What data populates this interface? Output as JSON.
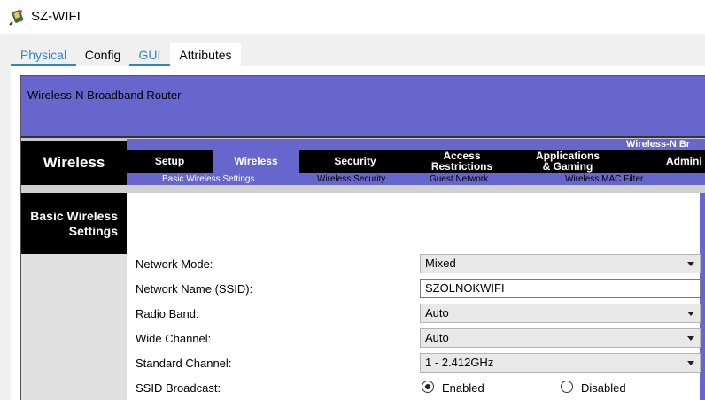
{
  "window": {
    "title": "SZ-WIFI",
    "icon": "router-device-icon"
  },
  "tabs": [
    {
      "label": "Physical",
      "active": false
    },
    {
      "label": "Config",
      "active": false
    },
    {
      "label": "GUI",
      "active": true
    },
    {
      "label": "Attributes",
      "active": false
    }
  ],
  "router": {
    "banner_title": "Wireless-N Broadband Router",
    "section_title": "Wireless",
    "product_label": "Wireless-N Br",
    "nav": [
      {
        "line1": "Setup"
      },
      {
        "line1": "Wireless",
        "selected": true
      },
      {
        "line1": "Security"
      },
      {
        "line1": "Access",
        "line2": "Restrictions"
      },
      {
        "line1": "Applications",
        "line2": "& Gaming"
      },
      {
        "line1": "Admini"
      }
    ],
    "subnav": [
      "Basic Wireless Settings",
      "Wireless Security",
      "Guest Network",
      "Wireless MAC Filter"
    ],
    "side_title_line1": "Basic Wireless",
    "side_title_line2": "Settings"
  },
  "form": {
    "network_mode": {
      "label": "Network Mode:",
      "value": "Mixed"
    },
    "ssid": {
      "label": "Network Name (SSID):",
      "value": "SZOLNOKWIFI"
    },
    "radio_band": {
      "label": "Radio Band:",
      "value": "Auto"
    },
    "wide_channel": {
      "label": "Wide Channel:",
      "value": "Auto"
    },
    "standard_channel": {
      "label": "Standard Channel:",
      "value": "1 - 2.412GHz"
    },
    "ssid_broadcast": {
      "label": "SSID Broadcast:",
      "enabled_label": "Enabled",
      "disabled_label": "Disabled",
      "selected": "Enabled"
    }
  },
  "colors": {
    "accent": "#2d86c8",
    "router_purple": "#6666cc",
    "black": "#000000"
  }
}
